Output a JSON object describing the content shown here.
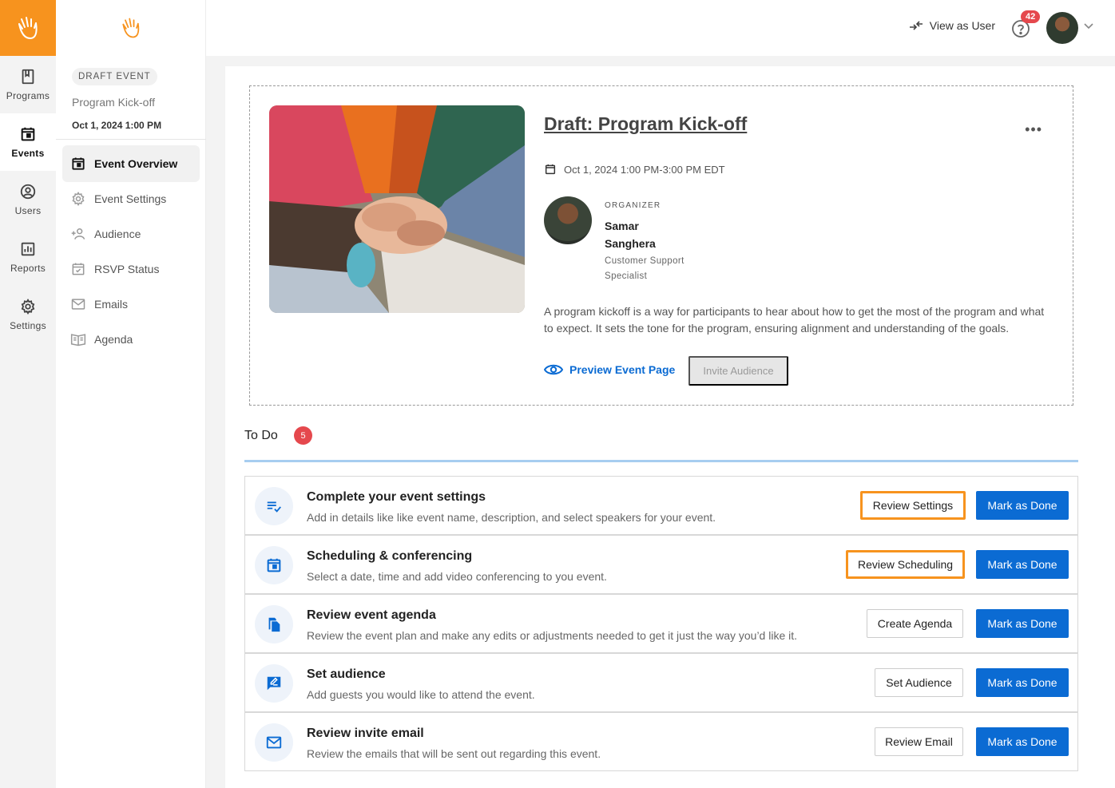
{
  "rail": {
    "items": [
      {
        "label": "Programs",
        "icon": "book-icon"
      },
      {
        "label": "Events",
        "icon": "calendar-icon"
      },
      {
        "label": "Users",
        "icon": "user-circle-icon"
      },
      {
        "label": "Reports",
        "icon": "chart-icon"
      },
      {
        "label": "Settings",
        "icon": "gear-icon"
      }
    ]
  },
  "sidebar": {
    "status_pill": "DRAFT EVENT",
    "event_name": "Program Kick-off",
    "event_date": "Oct 1, 2024 1:00 PM",
    "items": [
      {
        "label": "Event Overview",
        "icon": "calendar-icon"
      },
      {
        "label": "Event Settings",
        "icon": "gear-icon"
      },
      {
        "label": "Audience",
        "icon": "add-user-icon"
      },
      {
        "label": "RSVP Status",
        "icon": "calendar-check-icon"
      },
      {
        "label": "Emails",
        "icon": "mail-icon"
      },
      {
        "label": "Agenda",
        "icon": "book-open-icon"
      }
    ]
  },
  "topbar": {
    "view_as_user": "View as User",
    "notification_count": "42"
  },
  "event": {
    "title": "Draft: Program Kick-off",
    "more": "•••",
    "datetime": "Oct 1, 2024 1:00 PM-3:00 PM EDT",
    "organizer_label": "ORGANIZER",
    "organizer_name": "Samar Sanghera",
    "organizer_role": "Customer Support Specialist",
    "description": "A program kickoff is a way for participants to hear about how to get the most of the program and what to expect. It sets the tone for the program, ensuring alignment and understanding of the goals.",
    "preview_label": "Preview Event Page",
    "invite_label": "Invite Audience"
  },
  "todo": {
    "title": "To Do",
    "count": "5",
    "tasks": [
      {
        "title": "Complete your event settings",
        "subtitle": "Add in details like like event name, description, and select speakers for your event.",
        "action": "Review Settings",
        "done": "Mark as Done",
        "icon": "checklist-icon"
      },
      {
        "title": "Scheduling & conferencing",
        "subtitle": "Select a date, time and add video conferencing to you event.",
        "action": "Review Scheduling",
        "done": "Mark as Done",
        "icon": "calendar-icon"
      },
      {
        "title": "Review event agenda",
        "subtitle": "Review the event plan and make any edits or adjustments needed to get it just the way you’d like it.",
        "action": "Create Agenda",
        "done": "Mark as Done",
        "icon": "files-icon"
      },
      {
        "title": "Set audience",
        "subtitle": "Add guests you would like to attend the event.",
        "action": "Set Audience",
        "done": "Mark as Done",
        "icon": "edit-message-icon"
      },
      {
        "title": "Review invite email",
        "subtitle": "Review the emails that will be sent out regarding this event.",
        "action": "Review Email",
        "done": "Mark as Done",
        "icon": "mail-icon"
      }
    ]
  },
  "colors": {
    "brand": "#f7931e",
    "primary": "#0b6bd3",
    "badge": "#e5484d"
  }
}
